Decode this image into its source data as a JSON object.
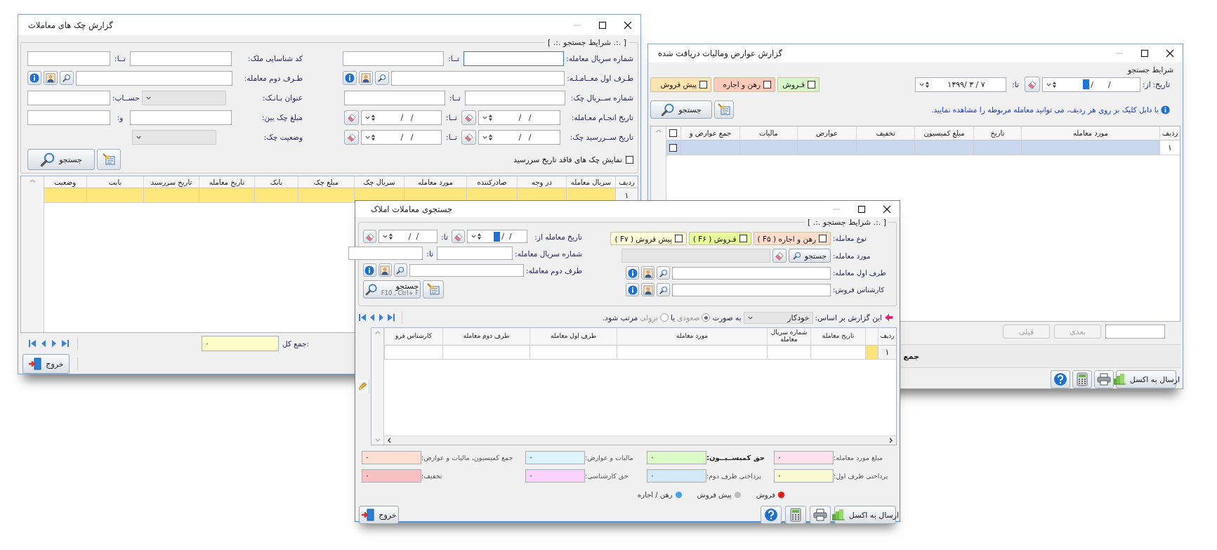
{
  "checks_report": {
    "title": "گزارش چک های معاملات",
    "group_title": "[ .:. شرایط جستجو .:. ]",
    "filters_right": [
      {
        "kind": "range",
        "label": "شماره سریال معامله:",
        "to_label": "تــا:",
        "focused": true
      },
      {
        "kind": "party",
        "label": "طـرف اول معــامـلـه:"
      },
      {
        "kind": "range",
        "label": "شماره ســریال چک:",
        "to_label": "تــا:"
      },
      {
        "kind": "date_range",
        "label": "تاریخ انجـام معـامله:",
        "to_label": "تــا:",
        "from": "/   /",
        "to": "/   /"
      },
      {
        "kind": "date_range",
        "label": "تاریخ ســررسید چک:",
        "to_label": "تــا:",
        "from": "/   /",
        "to": "/   /"
      }
    ],
    "filters_left": [
      {
        "kind": "range",
        "label": "کد شناسایی ملک:",
        "to_label": "تــا:"
      },
      {
        "kind": "party",
        "label": "طـرف دوم معامله:"
      },
      {
        "kind": "combo_pair",
        "label": "عنوان بـانـک:",
        "to_label": "حســاب:",
        "disabled": true
      },
      {
        "kind": "range",
        "label": "مبلغ چک بین:",
        "to_label": "و:"
      },
      {
        "kind": "combo",
        "label": "وضعیت چک:",
        "disabled": true
      }
    ],
    "no_due_date": {
      "label": "نمایش چک های فاقد تاریخ سررسید",
      "checked": false
    },
    "search_button": "جستجو",
    "table": {
      "columns": [
        "ردیف",
        "سریال معامله",
        "در وجه",
        "صادرکننده",
        "مورد معامله",
        "سریال چک",
        "مبلغ چک",
        "بانک",
        "تاریخ معامله",
        "تاریخ سررسید",
        "بابت",
        "وضعیت"
      ],
      "rows": [
        {
          "number": "۱",
          "selected": true
        }
      ]
    },
    "total": {
      "label": "جمع کل:",
      "value": "۰"
    },
    "exit_button": "خروج"
  },
  "taxes_report": {
    "title": "گزارش عوارض ومالیات دریافت شده",
    "group_title": "شرایط جستجو",
    "date": {
      "label": "تاریخ:",
      "from_label": "از:",
      "to_label": "تا:",
      "from": "/      /",
      "from_focused": true,
      "to": "۱۳۹۹/ ۳ / ۷"
    },
    "types": [
      {
        "label": "فـروش",
        "checked": false,
        "color": "#d6f7c8"
      },
      {
        "label": "رهن و اجاره",
        "checked": false,
        "color": "#fcc9ba"
      },
      {
        "label": "پیش فروش",
        "checked": false,
        "color": "#fde3b0"
      }
    ],
    "search_button": "جستجو",
    "hint": "با دابل کلیک بر روی هر ردیف، می توانید معامله مربوطه را مشاهده نمایید.",
    "table": {
      "columns": [
        "ردیف",
        "مورد معامله",
        "تاریخ",
        "مبلغ کمیسیون",
        "تخفیف",
        "عوارض",
        "مالیات",
        "جمع عوارض و"
      ],
      "select_all": false,
      "rows": [
        {
          "number": "۱",
          "selected": true,
          "checked": false
        }
      ]
    },
    "pager": {
      "next": "بعدی",
      "previous": "قبلی",
      "disabled": true
    },
    "total_label": "جمع",
    "excel_button": "ارسال به اکسل"
  },
  "property_search": {
    "title": "جستجوی معاملات املاک",
    "group_title": "[ .:. شرایط جستجو .:. ]",
    "deal_type": {
      "label": "نوع معامله:",
      "options": [
        {
          "label": "رهن و اجاره ( F۵ )",
          "checked": false,
          "color": "#fcdccb"
        },
        {
          "label": "فـروش ( F۶ )",
          "checked": false,
          "color": "#e8f99c"
        },
        {
          "label": "پیش فروش ( F۷ )",
          "checked": false,
          "color": "#fdfbd8"
        }
      ]
    },
    "subject": {
      "label": "مورد معامله:",
      "button": "جستجو",
      "disabled": true
    },
    "first_party": {
      "label": "طرف اول معامله:"
    },
    "sales_expert": {
      "label": "کارشناس فروش:"
    },
    "date": {
      "label": "تاریخ معامله از:",
      "to_label": "تا:",
      "from": "/  /",
      "from_focused": true,
      "to": "/  /"
    },
    "serial": {
      "label": "شماره سریال معامله:",
      "to_label": "تا:"
    },
    "second_party": {
      "label": "طرف دوم معامله:"
    },
    "search_button": {
      "label": "جستجو",
      "shortcut": "F10 , Ctrl+ F"
    },
    "sort": {
      "label": "این گزارش بر اساس:",
      "value": "خودکار",
      "as_label": "به صورت",
      "or_label": "یا",
      "suffix": "مرتب شود.",
      "options": [
        {
          "label": "صعودی",
          "selected": true
        },
        {
          "label": "نزولی",
          "selected": false
        }
      ]
    },
    "table": {
      "columns": [
        "ردیف",
        "تاریخ معامله",
        "شماره سریال معامله",
        "مورد معامله",
        "طرف اول معامله",
        "طرف دوم معامله",
        "کارشناس فرو"
      ],
      "rows": [
        {
          "number": "۱",
          "selected": true
        }
      ]
    },
    "totals": [
      {
        "label": "مبلغ مورد معامله:",
        "value": "۰",
        "color": "#fde1ee",
        "bold": false
      },
      {
        "label": "حق کمیســیــون:",
        "value": "۰",
        "color": "#ddfac9",
        "bold": true
      },
      {
        "label": "مالیات و عوارض:",
        "value": "۰",
        "color": "#dcf4fb",
        "bold": false
      },
      {
        "label": "جمع کمیسیون، مالیات و عوارض:",
        "value": "۰",
        "color": "#fde0d2",
        "bold": false
      },
      {
        "label": "پرداختی طرف اول:",
        "value": "۰",
        "color": "#fafad2",
        "bold": false
      },
      {
        "label": "پرداختی طرف دوم:",
        "value": "۰",
        "color": "#d2eaf5",
        "bold": false
      },
      {
        "label": "حق کارشناسی:",
        "value": "۰",
        "color": "#fcd2fb",
        "bold": false
      },
      {
        "label": "تخفیف:",
        "value": "۰",
        "color": "#f9c2c2",
        "bold": false
      }
    ],
    "legend": [
      {
        "label": "فروش",
        "color": "#e01818"
      },
      {
        "label": "پیش فروش",
        "color": "#bdbdbd"
      },
      {
        "label": "رهن / اجاره",
        "color": "#4aa3e0"
      }
    ],
    "excel_button": "ارسال به اکسل",
    "exit_button": "خروج"
  }
}
